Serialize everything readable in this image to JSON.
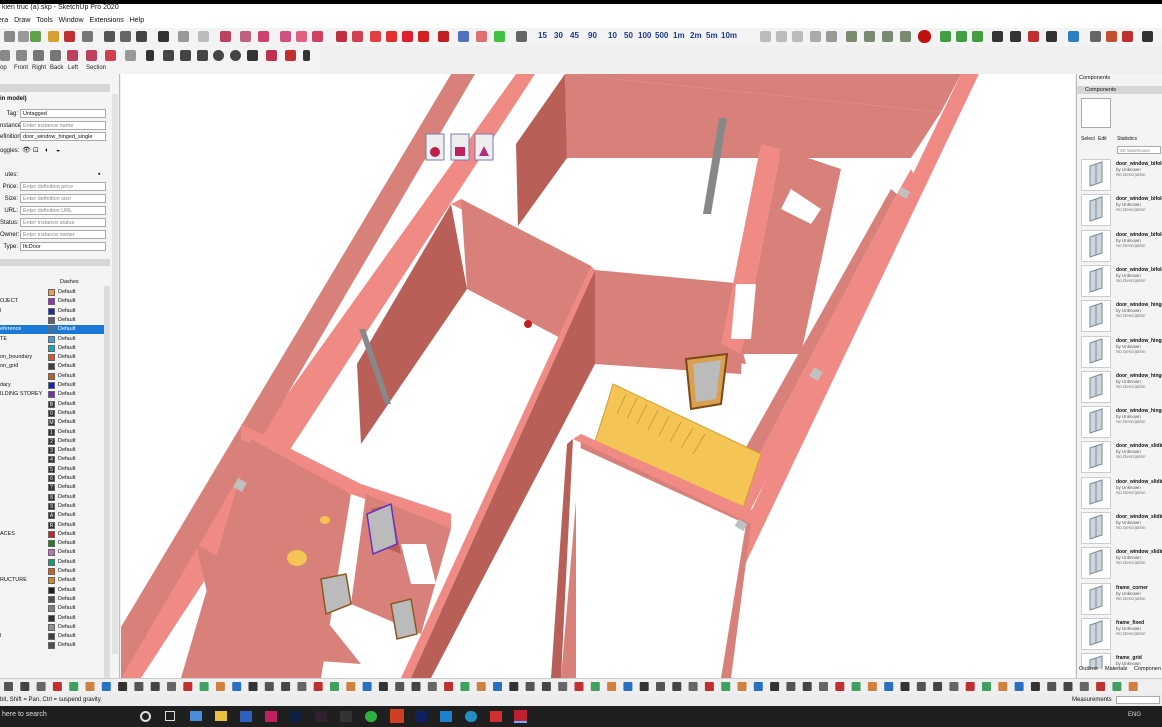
{
  "window": {
    "title": "kien truc (a).skp - SketchUp Pro 2020"
  },
  "menubar": {
    "items": [
      "era",
      "Draw",
      "Tools",
      "Window",
      "Extensions",
      "Help"
    ]
  },
  "zoom_buttons": [
    "15",
    "30",
    "45",
    "90",
    "10",
    "50",
    "100",
    "500",
    "1m",
    "2m",
    "5m",
    "10m"
  ],
  "view_buttons": [
    "op",
    "Front",
    "Right",
    "Back",
    "Left",
    "Section"
  ],
  "entity_info": {
    "title": "in model)",
    "tag_label": "Tag:",
    "tag_value": "Untagged",
    "instance_label": "nstance:",
    "instance_placeholder": "Enter instance name",
    "definition_label": "efinition:",
    "definition_value": "door_window_hinged_single",
    "toggles_label": "oggles:",
    "attributes_label": "utes:",
    "price_label": "Price:",
    "price_placeholder": "Enter definition price",
    "size_label": "Size:",
    "size_placeholder": "Enter definition size",
    "url_label": "URL:",
    "url_placeholder": "Enter definition URL",
    "status_label": "Status:",
    "status_placeholder": "Enter instance status",
    "owner_label": "Owner:",
    "owner_placeholder": "Enter instance owner",
    "type_label": "Type:",
    "type_value": "IfcDoor"
  },
  "tags_panel": {
    "dashes_header": "Dashes",
    "rows": [
      {
        "name": "",
        "color": "#f0a040",
        "dash": "Default"
      },
      {
        "name": "OJECT",
        "color": "#9b30c0",
        "dash": "Default"
      },
      {
        "name": "l",
        "color": "#1b2ca8",
        "dash": "Default"
      },
      {
        "name": "",
        "color": "#606070",
        "dash": "Default"
      },
      {
        "name": "eference",
        "color": "#1a78d6",
        "dash": "Default",
        "selected": true
      },
      {
        "name": "TE",
        "color": "#3aa0e0",
        "dash": "Default"
      },
      {
        "name": "",
        "color": "#00b0c0",
        "dash": "Default"
      },
      {
        "name": "on_boundary",
        "color": "#e05020",
        "dash": "Default"
      },
      {
        "name": "on_grid",
        "color": "#404040",
        "dash": "Default"
      },
      {
        "name": "",
        "color": "#c06020",
        "dash": "Default"
      },
      {
        "name": "dary",
        "color": "#2020c0",
        "dash": "Default"
      },
      {
        "name": "ILDING STOREY",
        "color": "#7030b0",
        "dash": "Default"
      },
      {
        "name": "",
        "color": "#303030",
        "dash": "Default",
        "glyph": "B"
      },
      {
        "name": "",
        "color": "#303030",
        "dash": "Default",
        "glyph": "0"
      },
      {
        "name": "",
        "color": "#303030",
        "dash": "Default",
        "glyph": "M"
      },
      {
        "name": "",
        "color": "#303030",
        "dash": "Default",
        "glyph": "1"
      },
      {
        "name": "",
        "color": "#303030",
        "dash": "Default",
        "glyph": "2"
      },
      {
        "name": "",
        "color": "#303030",
        "dash": "Default",
        "glyph": "3"
      },
      {
        "name": "",
        "color": "#303030",
        "dash": "Default",
        "glyph": "4"
      },
      {
        "name": "",
        "color": "#303030",
        "dash": "Default",
        "glyph": "5"
      },
      {
        "name": "",
        "color": "#303030",
        "dash": "Default",
        "glyph": "6"
      },
      {
        "name": "",
        "color": "#303030",
        "dash": "Default",
        "glyph": "7"
      },
      {
        "name": "",
        "color": "#303030",
        "dash": "Default",
        "glyph": "8"
      },
      {
        "name": "",
        "color": "#303030",
        "dash": "Default",
        "glyph": "9"
      },
      {
        "name": "",
        "color": "#303030",
        "dash": "Default",
        "glyph": "A"
      },
      {
        "name": "",
        "color": "#303030",
        "dash": "Default",
        "glyph": "R"
      },
      {
        "name": "ACES",
        "color": "#d02020",
        "dash": "Default"
      },
      {
        "name": "",
        "color": "#208020",
        "dash": "Default"
      },
      {
        "name": "",
        "color": "#c070c0",
        "dash": "Default"
      },
      {
        "name": "",
        "color": "#10a080",
        "dash": "Default"
      },
      {
        "name": "",
        "color": "#d06010",
        "dash": "Default"
      },
      {
        "name": "RUCTURE",
        "color": "#e08020",
        "dash": "Default"
      },
      {
        "name": "",
        "color": "#202020",
        "dash": "Default"
      },
      {
        "name": "",
        "color": "#505050",
        "dash": "Default"
      },
      {
        "name": "",
        "color": "#808080",
        "dash": "Default"
      },
      {
        "name": "",
        "color": "#303030",
        "dash": "Default"
      },
      {
        "name": "",
        "color": "#909090",
        "dash": "Default"
      },
      {
        "name": "l",
        "color": "#404040",
        "dash": "Default"
      },
      {
        "name": "",
        "color": "#505050",
        "dash": "Default"
      }
    ]
  },
  "components_panel": {
    "title": "Components",
    "section": "Components",
    "tabs": [
      "Select",
      "Edit",
      "Statistics"
    ],
    "search_placeholder": "3D Warehouse",
    "items": [
      {
        "name": "door_window_bifold_",
        "by": "by Unknown",
        "desc": "No Description"
      },
      {
        "name": "door_window_bifold_",
        "by": "by Unknown",
        "desc": "No Description"
      },
      {
        "name": "door_window_bifold_",
        "by": "by Unknown",
        "desc": "No Description"
      },
      {
        "name": "door_window_bifold_",
        "by": "by Unknown",
        "desc": "No Description"
      },
      {
        "name": "door_window_hinged",
        "by": "by Unknown",
        "desc": "No Description"
      },
      {
        "name": "door_window_hinged",
        "by": "by Unknown",
        "desc": "No Description"
      },
      {
        "name": "door_window_hinged",
        "by": "by Unknown",
        "desc": "No Description"
      },
      {
        "name": "door_window_hinged",
        "by": "by Unknown",
        "desc": "No Description"
      },
      {
        "name": "door_window_sliding",
        "by": "by Unknown",
        "desc": "No Description"
      },
      {
        "name": "door_window_sliding",
        "by": "by Unknown",
        "desc": "No Description"
      },
      {
        "name": "door_window_sliding",
        "by": "by Unknown",
        "desc": "No Description"
      },
      {
        "name": "door_window_sliding",
        "by": "by Unknown",
        "desc": "No Description"
      },
      {
        "name": "frame_corner",
        "by": "by Unknown",
        "desc": "No Description"
      },
      {
        "name": "frame_fixed",
        "by": "by Unknown",
        "desc": "No Description"
      },
      {
        "name": "frame_grid",
        "by": "by Unknown",
        "desc": ""
      }
    ],
    "bottom_tabs": [
      "Outliner",
      "Materials",
      "Componen"
    ]
  },
  "status": {
    "hint": "bit, Shift = Pan, Ctrl = suspend gravity.",
    "measurements_label": "Measurements"
  },
  "taskbar": {
    "search_text": "here to search",
    "language": "ENG"
  },
  "colors": {
    "wall_face": "#d8817a",
    "wall_side": "#b85f58",
    "wall_top": "#f08a84",
    "stairs": "#f4c455",
    "selection": "#1a78d6"
  }
}
